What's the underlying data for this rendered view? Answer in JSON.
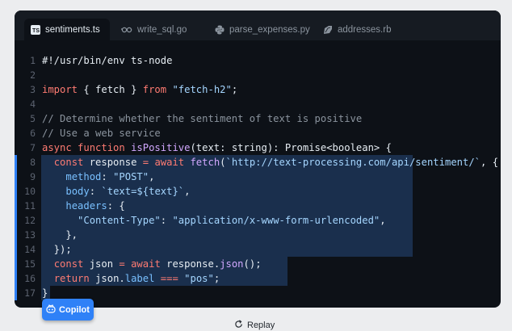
{
  "tabs": [
    {
      "label": "sentiments.ts",
      "icon": "typescript-icon",
      "active": true
    },
    {
      "label": "write_sql.go",
      "icon": "go-icon",
      "active": false
    },
    {
      "label": "parse_expenses.py",
      "icon": "python-icon",
      "active": false
    },
    {
      "label": "addresses.rb",
      "icon": "ruby-icon",
      "active": false
    }
  ],
  "ts_badge": "TS",
  "code_lines": [
    {
      "n": "1",
      "segs": [
        [
          "",
          "#!/usr/bin/env ts-node"
        ]
      ]
    },
    {
      "n": "2",
      "segs": []
    },
    {
      "n": "3",
      "segs": [
        [
          "k",
          "import"
        ],
        [
          "",
          " { fetch } "
        ],
        [
          "k",
          "from"
        ],
        [
          "",
          " "
        ],
        [
          "s",
          "\"fetch-h2\""
        ],
        [
          "",
          ";"
        ]
      ]
    },
    {
      "n": "4",
      "segs": []
    },
    {
      "n": "5",
      "segs": [
        [
          "c",
          "// Determine whether the sentiment of text is positive"
        ]
      ]
    },
    {
      "n": "6",
      "segs": [
        [
          "c",
          "// Use a web service"
        ]
      ]
    },
    {
      "n": "7",
      "segs": [
        [
          "k",
          "async function"
        ],
        [
          "",
          " "
        ],
        [
          "f",
          "isPositive"
        ],
        [
          "",
          "(text: string): Promise<boolean> {"
        ]
      ]
    },
    {
      "n": "8",
      "segs": [
        [
          "",
          "  "
        ],
        [
          "k",
          "const"
        ],
        [
          "",
          " response "
        ],
        [
          "k",
          "="
        ],
        [
          "",
          " "
        ],
        [
          "k",
          "await"
        ],
        [
          "",
          " "
        ],
        [
          "f",
          "fetch"
        ],
        [
          "",
          "("
        ],
        [
          "s",
          "`http://text-processing.com/api/sentiment/`"
        ],
        [
          "",
          ", {"
        ]
      ]
    },
    {
      "n": "9",
      "segs": [
        [
          "",
          "    "
        ],
        [
          "p",
          "method"
        ],
        [
          "",
          ": "
        ],
        [
          "s",
          "\"POST\""
        ],
        [
          "",
          ","
        ]
      ]
    },
    {
      "n": "10",
      "segs": [
        [
          "",
          "    "
        ],
        [
          "p",
          "body"
        ],
        [
          "",
          ": "
        ],
        [
          "s",
          "`text=${text}`"
        ],
        [
          "",
          ","
        ]
      ]
    },
    {
      "n": "11",
      "segs": [
        [
          "",
          "    "
        ],
        [
          "p",
          "headers"
        ],
        [
          "",
          ": {"
        ]
      ]
    },
    {
      "n": "12",
      "segs": [
        [
          "",
          "      "
        ],
        [
          "s",
          "\"Content-Type\""
        ],
        [
          "",
          ": "
        ],
        [
          "s",
          "\"application/x-www-form-urlencoded\""
        ],
        [
          "",
          ","
        ]
      ]
    },
    {
      "n": "13",
      "segs": [
        [
          "",
          "    },"
        ]
      ]
    },
    {
      "n": "14",
      "segs": [
        [
          "",
          "  });"
        ]
      ]
    },
    {
      "n": "15",
      "segs": [
        [
          "",
          "  "
        ],
        [
          "k",
          "const"
        ],
        [
          "",
          " json "
        ],
        [
          "k",
          "="
        ],
        [
          "",
          " "
        ],
        [
          "k",
          "await"
        ],
        [
          "",
          " response."
        ],
        [
          "f",
          "json"
        ],
        [
          "",
          "();"
        ]
      ]
    },
    {
      "n": "16",
      "segs": [
        [
          "",
          "  "
        ],
        [
          "k",
          "return"
        ],
        [
          "",
          " json."
        ],
        [
          "p",
          "label"
        ],
        [
          "",
          " "
        ],
        [
          "k",
          "==="
        ],
        [
          "",
          " "
        ],
        [
          "s",
          "\"pos\""
        ],
        [
          "",
          ";"
        ]
      ]
    },
    {
      "n": "17",
      "segs": [
        [
          "",
          "}"
        ]
      ]
    }
  ],
  "highlight": [
    {
      "n": "8",
      "highlight_chars": 62
    },
    {
      "n": "9",
      "highlight_chars": 62
    },
    {
      "n": "10",
      "highlight_chars": 62
    },
    {
      "n": "11",
      "highlight_chars": 62
    },
    {
      "n": "12",
      "highlight_chars": 62
    },
    {
      "n": "13",
      "highlight_chars": 62
    },
    {
      "n": "14",
      "highlight_chars": 62
    },
    {
      "n": "15",
      "highlight_chars": 41
    },
    {
      "n": "16",
      "highlight_chars": 41
    },
    {
      "n": "17",
      "highlight_chars": 1
    }
  ],
  "copilot": {
    "label": "Copilot",
    "icon": "copilot-icon"
  },
  "replay": {
    "label": "Replay",
    "icon": "replay-icon"
  },
  "colors": {
    "accent": "#2f81f7",
    "editor_bg": "#0d1117",
    "keyword": "#ff7b72",
    "string": "#a5d6ff",
    "function": "#d2a8ff"
  }
}
